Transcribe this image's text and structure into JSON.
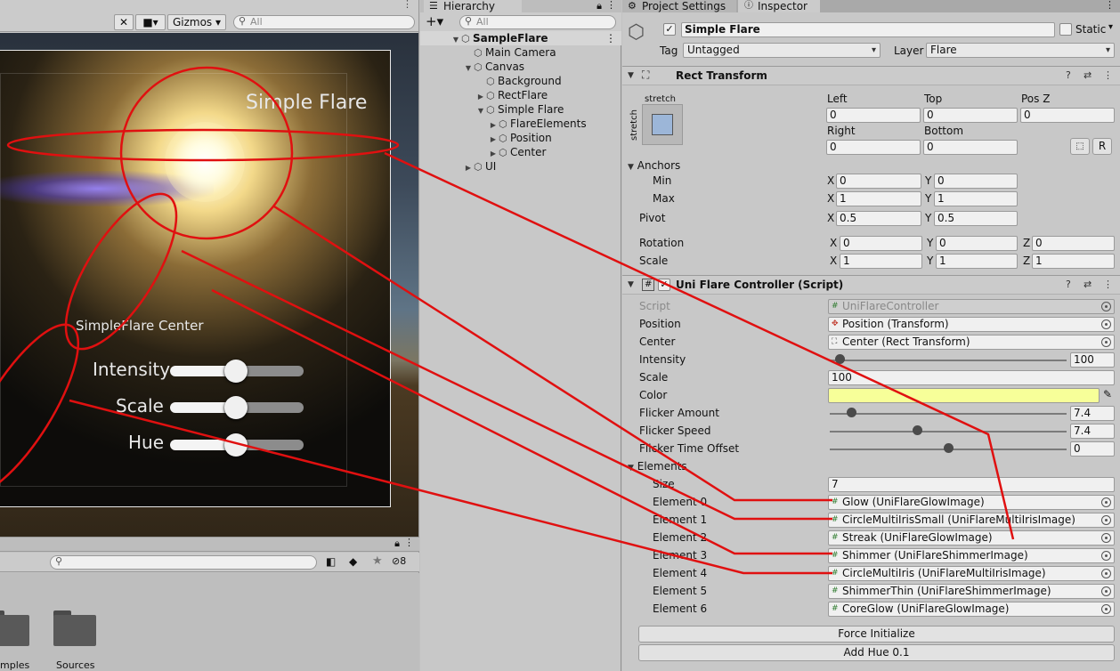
{
  "scene": {
    "gizmos_label": "Gizmos",
    "search_placeholder": "All",
    "flare_title": "Simple Flare",
    "center_label": "SimpleFlare Center",
    "sliders": [
      {
        "label": "Intensity",
        "value": 0.5
      },
      {
        "label": "Scale",
        "value": 0.5
      },
      {
        "label": "Hue",
        "value": 0.5
      }
    ]
  },
  "project": {
    "visibility_count": "8",
    "folders": [
      {
        "label": "mples"
      },
      {
        "label": "Sources"
      }
    ]
  },
  "hierarchy": {
    "tab_label": "Hierarchy",
    "search_placeholder": "All",
    "items": [
      {
        "label": "SampleFlare",
        "depth": 0,
        "arrow": "▼",
        "bold": true
      },
      {
        "label": "Main Camera",
        "depth": 1,
        "arrow": ""
      },
      {
        "label": "Canvas",
        "depth": 1,
        "arrow": "▼"
      },
      {
        "label": "Background",
        "depth": 2,
        "arrow": ""
      },
      {
        "label": "RectFlare",
        "depth": 2,
        "arrow": "▶"
      },
      {
        "label": "Simple Flare",
        "depth": 2,
        "arrow": "▼"
      },
      {
        "label": "FlareElements",
        "depth": 3,
        "arrow": "▶"
      },
      {
        "label": "Position",
        "depth": 3,
        "arrow": "▶"
      },
      {
        "label": "Center",
        "depth": 3,
        "arrow": "▶"
      },
      {
        "label": "UI",
        "depth": 1,
        "arrow": "▶"
      }
    ]
  },
  "inspector": {
    "tabs": {
      "project_settings": "Project Settings",
      "inspector": "Inspector"
    },
    "object_name": "Simple Flare",
    "static_label": "Static",
    "tag_label": "Tag",
    "tag_value": "Untagged",
    "layer_label": "Layer",
    "layer_value": "Flare",
    "rect": {
      "title": "Rect Transform",
      "stretch_top": "stretch",
      "stretch_side": "stretch",
      "left_label": "Left",
      "left": "0",
      "top_label": "Top",
      "top": "0",
      "posz_label": "Pos Z",
      "posz": "0",
      "right_label": "Right",
      "right": "0",
      "bottom_label": "Bottom",
      "bottom": "0",
      "r_button": "R",
      "anchors_label": "Anchors",
      "min_label": "Min",
      "min_x": "0",
      "min_y": "0",
      "max_label": "Max",
      "max_x": "1",
      "max_y": "1",
      "pivot_label": "Pivot",
      "pivot_x": "0.5",
      "pivot_y": "0.5",
      "rotation_label": "Rotation",
      "rot_x": "0",
      "rot_y": "0",
      "rot_z": "0",
      "scale_label": "Scale",
      "scale_x": "1",
      "scale_y": "1",
      "scale_z": "1",
      "x": "X",
      "y": "Y",
      "z": "Z"
    },
    "controller": {
      "title": "Uni Flare Controller (Script)",
      "script_label": "Script",
      "script_value": "UniFlareController",
      "position_label": "Position",
      "position_value": "Position (Transform)",
      "center_label": "Center",
      "center_value": "Center (Rect Transform)",
      "intensity_label": "Intensity",
      "intensity_value": "100",
      "intensity_frac": 0.04,
      "scale_label": "Scale",
      "scale_value": "100",
      "color_label": "Color",
      "color_hex": "#f7ff99",
      "flicker_amount_label": "Flicker Amount",
      "flicker_amount_value": "7.4",
      "flicker_amount_frac": 0.09,
      "flicker_speed_label": "Flicker Speed",
      "flicker_speed_value": "7.4",
      "flicker_speed_frac": 0.37,
      "flicker_offset_label": "Flicker Time Offset",
      "flicker_offset_value": "0",
      "flicker_offset_frac": 0.5,
      "elements_label": "Elements",
      "size_label": "Size",
      "size_value": "7",
      "elements": [
        {
          "label": "Element 0",
          "value": "Glow (UniFlareGlowImage)"
        },
        {
          "label": "Element 1",
          "value": "CircleMultiIrisSmall (UniFlareMultiIrisImage)"
        },
        {
          "label": "Element 2",
          "value": "Streak (UniFlareGlowImage)"
        },
        {
          "label": "Element 3",
          "value": "Shimmer (UniFlareShimmerImage)"
        },
        {
          "label": "Element 4",
          "value": "CircleMultiIris (UniFlareMultiIrisImage)"
        },
        {
          "label": "Element 5",
          "value": "ShimmerThin (UniFlareShimmerImage)"
        },
        {
          "label": "Element 6",
          "value": "CoreGlow (UniFlareGlowImage)"
        }
      ],
      "force_initialize": "Force Initialize",
      "add_hue": "Add Hue 0.1"
    }
  },
  "colors": {
    "annotation_red": "#e01010",
    "panel": "#c8c8c8",
    "accent_color_field": "#f7ff99"
  }
}
